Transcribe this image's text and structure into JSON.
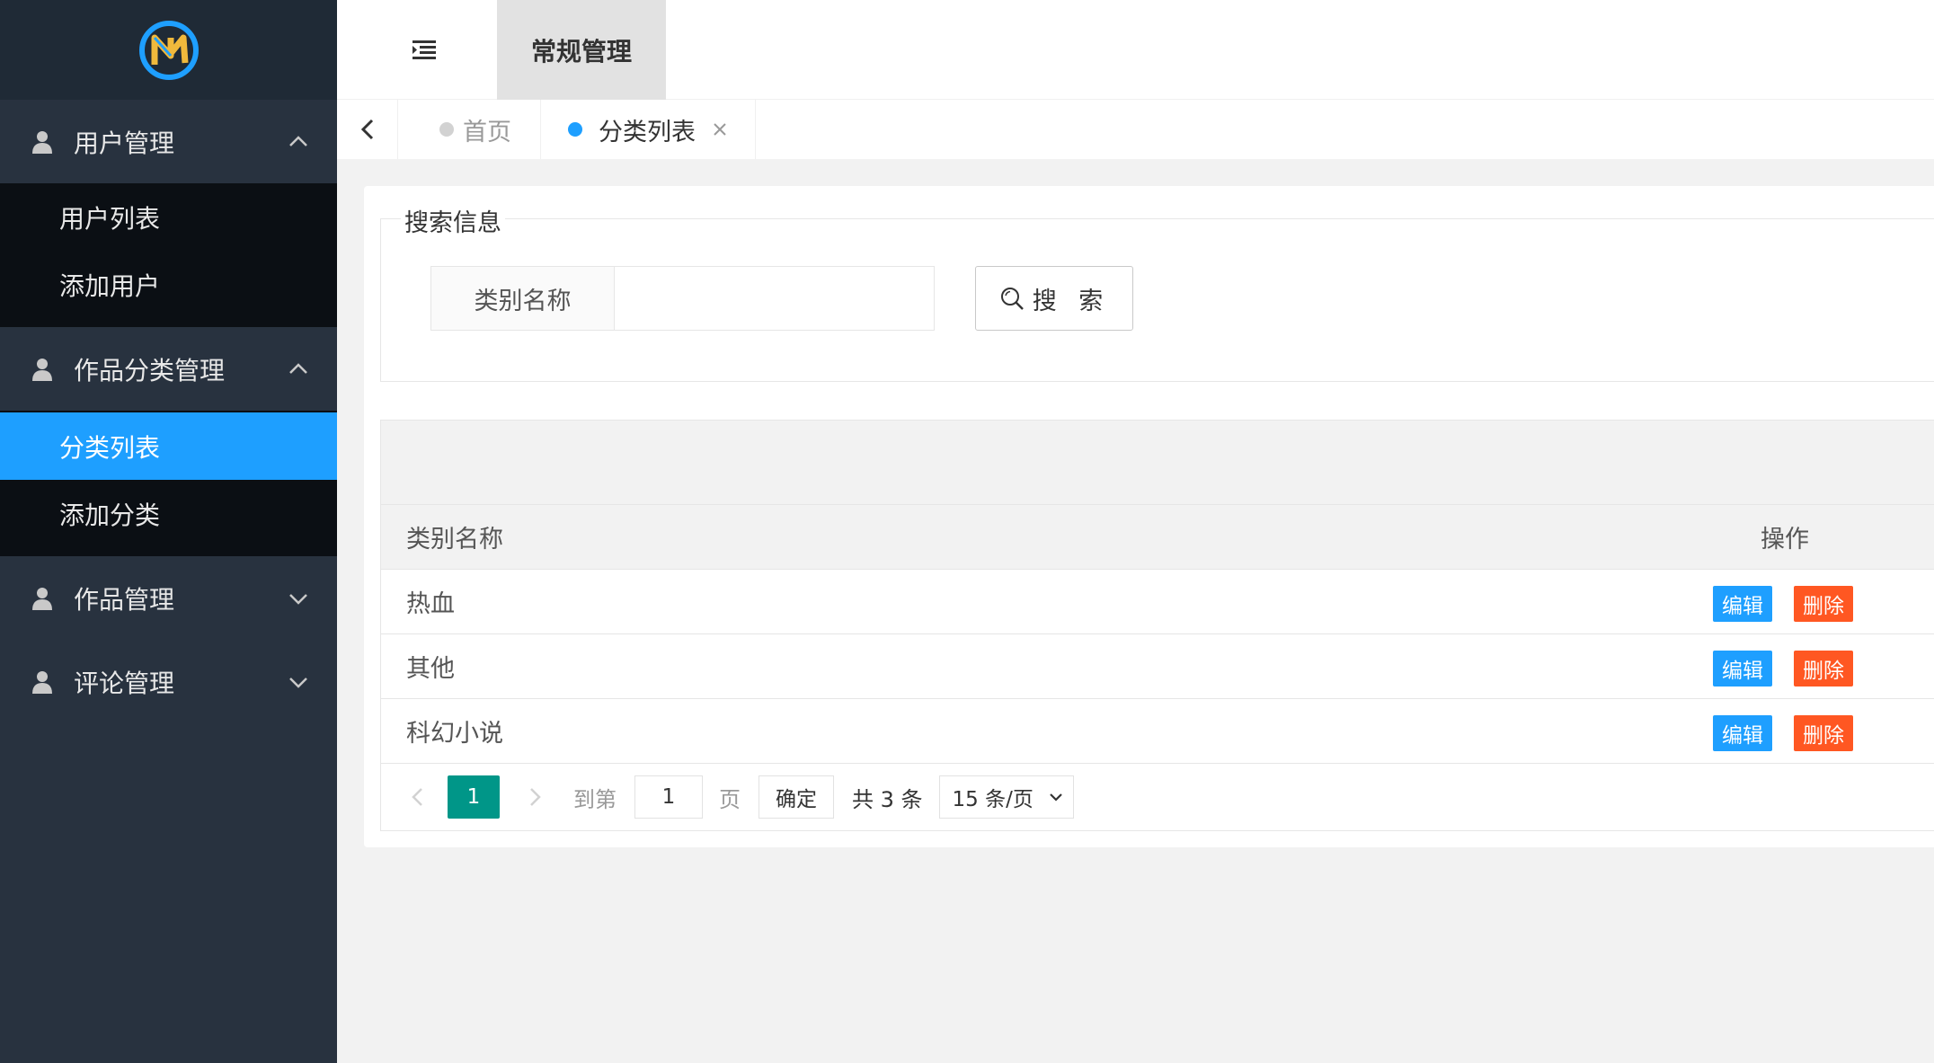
{
  "header": {
    "tab_label": "常规管理"
  },
  "sidebar": {
    "groups": [
      {
        "label": "用户管理",
        "expanded": true,
        "items": [
          "用户列表",
          "添加用户"
        ]
      },
      {
        "label": "作品分类管理",
        "expanded": true,
        "items": [
          "分类列表",
          "添加分类"
        ],
        "active_item": "分类列表"
      },
      {
        "label": "作品管理",
        "expanded": false
      },
      {
        "label": "评论管理",
        "expanded": false
      }
    ]
  },
  "tabs": [
    {
      "label": "首页",
      "active": false
    },
    {
      "label": "分类列表",
      "active": true
    }
  ],
  "search": {
    "legend": "搜索信息",
    "field_label": "类别名称",
    "field_value": "",
    "button_label": "搜 索"
  },
  "table": {
    "columns": [
      "类别名称",
      "操作"
    ],
    "rows": [
      {
        "name": "热血"
      },
      {
        "name": "其他"
      },
      {
        "name": "科幻小说"
      }
    ],
    "edit_label": "编辑",
    "delete_label": "删除"
  },
  "pager": {
    "current_page": "1",
    "goto_label": "到第",
    "goto_value": "1",
    "page_suffix": "页",
    "confirm_label": "确定",
    "total_text": "共 3 条",
    "page_size_label": "15 条/页"
  },
  "colors": {
    "sidebar_bg": "#28323f",
    "submenu_bg": "#0b0f14",
    "active_blue": "#1e9fff",
    "delete_red": "#ff5722",
    "pager_teal": "#009688"
  }
}
